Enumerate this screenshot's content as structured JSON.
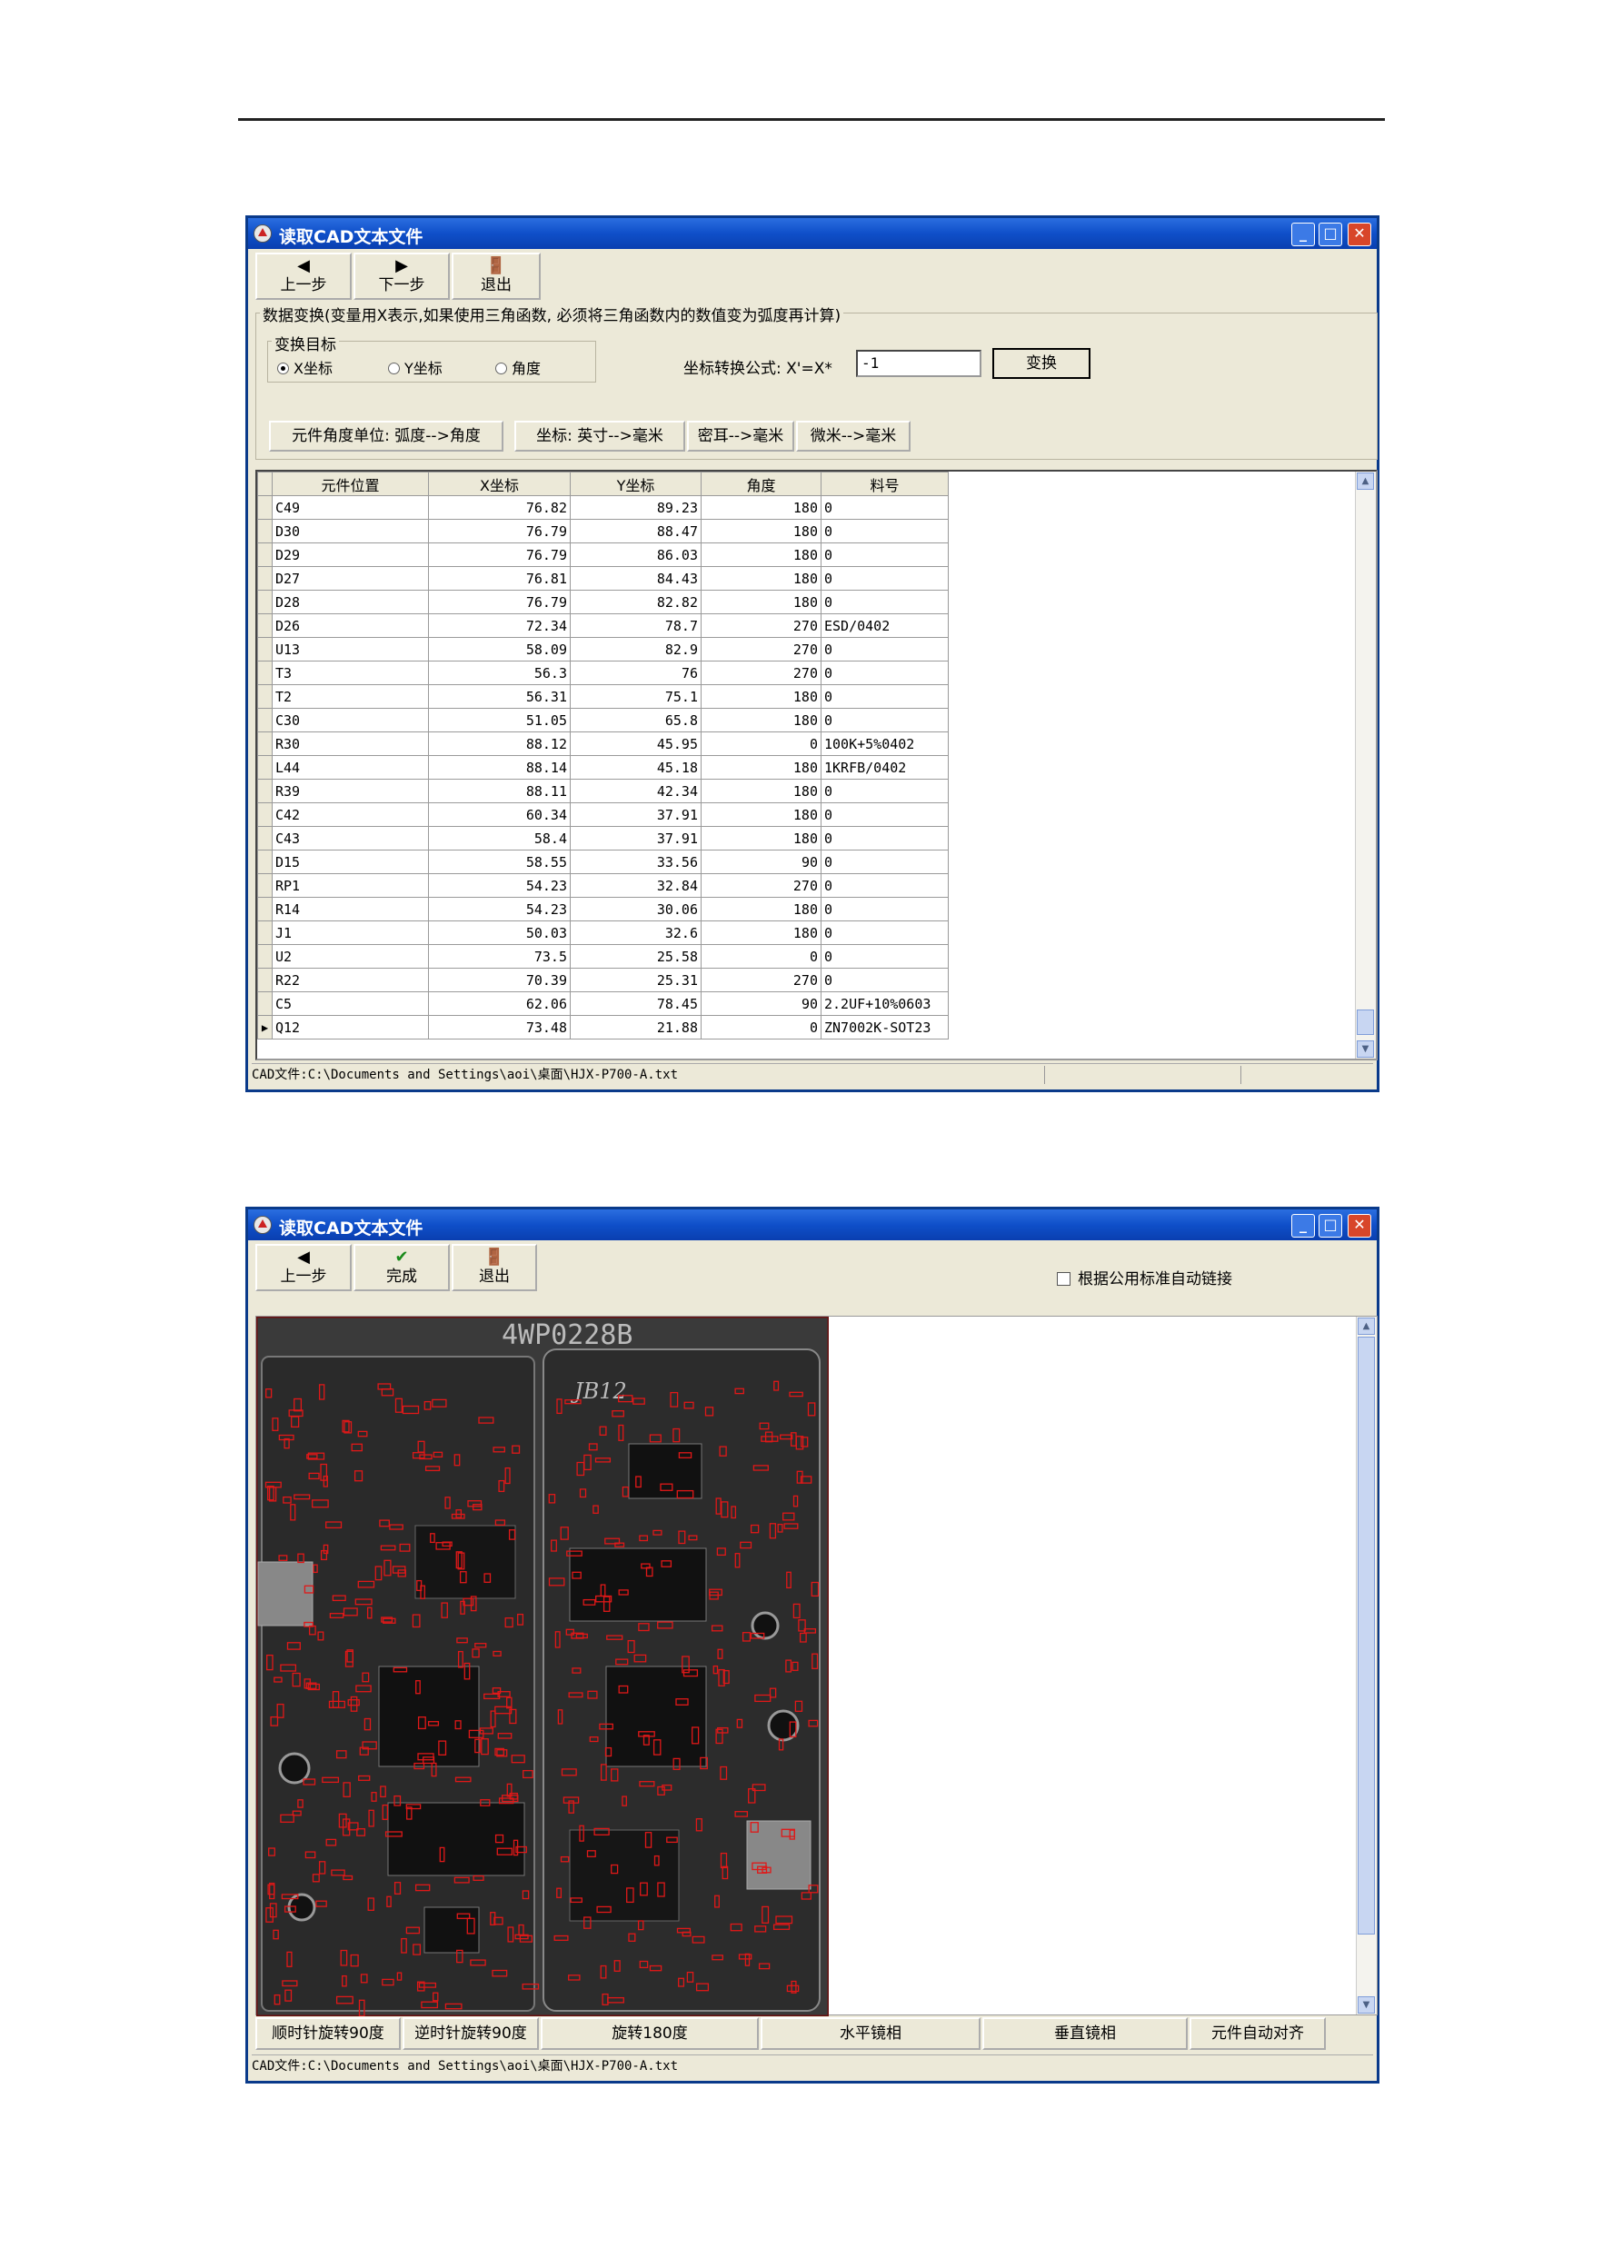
{
  "window1": {
    "title": "读取CAD文本文件",
    "toolbar": {
      "prev": "上一步",
      "next": "下一步",
      "exit": "退出"
    },
    "transform_group": "数据变换(变量用X表示,如果使用三角函数, 必须将三角函数内的数值变为弧度再计算)",
    "target_group": "变换目标",
    "radios": [
      "X坐标",
      "Y坐标",
      "角度"
    ],
    "formula_label": "坐标转换公式: X'=X*",
    "formula_value": "-1",
    "transform_button": "变换",
    "unit_buttons": [
      "元件角度单位: 弧度-->角度",
      "坐标: 英寸-->毫米",
      "密耳-->毫米",
      "微米-->毫米"
    ],
    "columns": [
      "元件位置",
      "X坐标",
      "Y坐标",
      "角度",
      "料号"
    ],
    "rows": [
      [
        "C49",
        "76.82",
        "89.23",
        "180",
        "0"
      ],
      [
        "D30",
        "76.79",
        "88.47",
        "180",
        "0"
      ],
      [
        "D29",
        "76.79",
        "86.03",
        "180",
        "0"
      ],
      [
        "D27",
        "76.81",
        "84.43",
        "180",
        "0"
      ],
      [
        "D28",
        "76.79",
        "82.82",
        "180",
        "0"
      ],
      [
        "D26",
        "72.34",
        "78.7",
        "270",
        "ESD/0402"
      ],
      [
        "U13",
        "58.09",
        "82.9",
        "270",
        "0"
      ],
      [
        "T3",
        "56.3",
        "76",
        "270",
        "0"
      ],
      [
        "T2",
        "56.31",
        "75.1",
        "180",
        "0"
      ],
      [
        "C30",
        "51.05",
        "65.8",
        "180",
        "0"
      ],
      [
        "R30",
        "88.12",
        "45.95",
        "0",
        "100K+5%0402"
      ],
      [
        "L44",
        "88.14",
        "45.18",
        "180",
        "1KRFB/0402"
      ],
      [
        "R39",
        "88.11",
        "42.34",
        "180",
        "0"
      ],
      [
        "C42",
        "60.34",
        "37.91",
        "180",
        "0"
      ],
      [
        "C43",
        "58.4",
        "37.91",
        "180",
        "0"
      ],
      [
        "D15",
        "58.55",
        "33.56",
        "90",
        "0"
      ],
      [
        "RP1",
        "54.23",
        "32.84",
        "270",
        "0"
      ],
      [
        "R14",
        "54.23",
        "30.06",
        "180",
        "0"
      ],
      [
        "J1",
        "50.03",
        "32.6",
        "180",
        "0"
      ],
      [
        "U2",
        "73.5",
        "25.58",
        "0",
        "0"
      ],
      [
        "R22",
        "70.39",
        "25.31",
        "270",
        "0"
      ],
      [
        "C5",
        "62.06",
        "78.45",
        "90",
        "2.2UF+10%0603"
      ],
      [
        "Q12",
        "73.48",
        "21.88",
        "0",
        "ZN7002K-SOT23"
      ]
    ],
    "status": "CAD文件:C:\\Documents and Settings\\aoi\\桌面\\HJX-P700-A.txt"
  },
  "window2": {
    "title": "读取CAD文本文件",
    "toolbar": {
      "prev": "上一步",
      "done": "完成",
      "exit": "退出"
    },
    "auto_link": "根据公用标准自动链接",
    "board_text": "4WP0228B",
    "board_mark": "JB12",
    "bottom_buttons": [
      "顺时针旋转90度",
      "逆时针旋转90度",
      "旋转180度",
      "水平镜相",
      "垂直镜相",
      "元件自动对齐"
    ],
    "status": "CAD文件:C:\\Documents and Settings\\aoi\\桌面\\HJX-P700-A.txt"
  },
  "colors": {
    "titlebar": "#0f4fc9",
    "window_bg": "#ece9d8",
    "component_outline": "#e01818"
  }
}
